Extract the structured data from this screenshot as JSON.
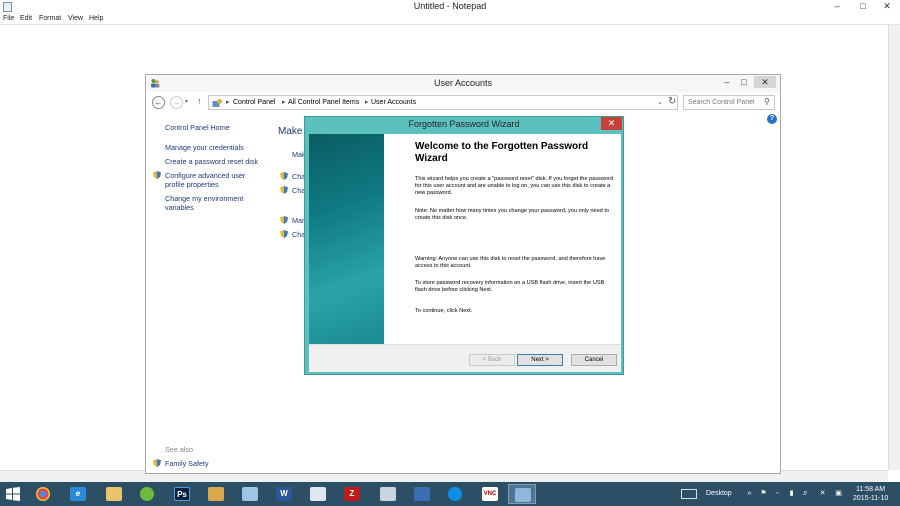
{
  "notepad": {
    "title": "Untitled - Notepad",
    "menu": [
      "File",
      "Edit",
      "Format",
      "View",
      "Help"
    ]
  },
  "user_accounts": {
    "title": "User Accounts",
    "breadcrumbs": [
      "Control Panel",
      "All Control Panel Items",
      "User Accounts"
    ],
    "search_placeholder": "Search Control Panel",
    "sidebar": {
      "home": "Control Panel Home",
      "links": [
        "Manage your credentials",
        "Create a password reset disk",
        "Configure advanced user profile properties",
        "Change my environment variables"
      ],
      "see_also": "See also",
      "family_safety": "Family Safety"
    },
    "main_heading_fragment": "Make c",
    "main_link_fragments": [
      "Mak",
      "Cha",
      "Cha",
      "Man",
      "Cha"
    ]
  },
  "wizard": {
    "title": "Forgotten Password Wizard",
    "heading": "Welcome to the Forgotten Password Wizard",
    "para1": "This wizard helps you create a \"password reset\" disk. If you forget the password for this user account and are unable to log on, you can use this disk to create a new password.",
    "para2": "Note: No matter how many times you change your password, you only need to create this disk once.",
    "para3": "Warning: Anyone can use this disk to reset the password, and therefore have access to this account.",
    "para4": "To store password recovery information on a USB flash drive, insert the USB flash drive before clicking Next.",
    "para5": "To continue, click Next.",
    "buttons": {
      "back": "< Back",
      "next": "Next >",
      "cancel": "Cancel"
    }
  },
  "taskbar": {
    "desktop_label": "Desktop",
    "time": "11:58 AM",
    "date": "2015-11-10",
    "apps": [
      "chrome-icon",
      "internet-explorer-icon",
      "file-explorer-icon",
      "app-green-icon",
      "photoshop-icon",
      "folder-icon",
      "app-blue-icon",
      "word-icon",
      "document-icon",
      "filezilla-icon",
      "network-icon",
      "app-icon",
      "teamviewer-icon",
      "vnc-icon",
      "control-panel-icon"
    ],
    "photoshop_text": "Ps"
  },
  "colors": {
    "wizard_frame": "#5cc1bd",
    "wizard_close": "#c7403a",
    "taskbar": "#2d4f66",
    "link": "#1e3a7b"
  }
}
